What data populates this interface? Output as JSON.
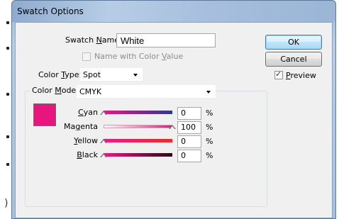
{
  "window": {
    "title": "Swatch Options"
  },
  "swatch_name": {
    "label_pre": "Swatch ",
    "label_key": "N",
    "label_post": "ame:",
    "value": "White"
  },
  "name_with_color_value": {
    "label_pre": "Name with Color ",
    "label_key": "V",
    "label_post": "alue",
    "checked": false,
    "enabled": false
  },
  "color_type": {
    "label_pre": "Color ",
    "label_key": "T",
    "label_post": "ype:",
    "value": "Spot"
  },
  "color_mode": {
    "label_pre": "Color ",
    "label_key": "M",
    "label_post": "ode:",
    "value": "CMYK"
  },
  "swatch_preview": {
    "color": "#e8157f"
  },
  "channels": [
    {
      "key": "C",
      "rest": "yan",
      "value": "0",
      "unit": "%",
      "level": 0.0,
      "gradient": [
        "#e8157f",
        "#2b3a8f"
      ]
    },
    {
      "pre": "Ma",
      "key": "g",
      "rest": "enta",
      "value": "100",
      "unit": "%",
      "level": 1.0,
      "gradient": [
        "#ffffff",
        "#e5177f"
      ]
    },
    {
      "key": "Y",
      "rest": "ellow",
      "value": "0",
      "unit": "%",
      "level": 0.0,
      "gradient": [
        "#ec1a83",
        "#ee2d2a"
      ]
    },
    {
      "key": "B",
      "rest": "lack",
      "value": "0",
      "unit": "%",
      "level": 0.0,
      "gradient": [
        "#ec1a83",
        "#2a0a14"
      ]
    }
  ],
  "buttons": {
    "ok": "OK",
    "cancel": "Cancel"
  },
  "preview": {
    "label_key": "P",
    "label_post": "review",
    "checked": true
  }
}
